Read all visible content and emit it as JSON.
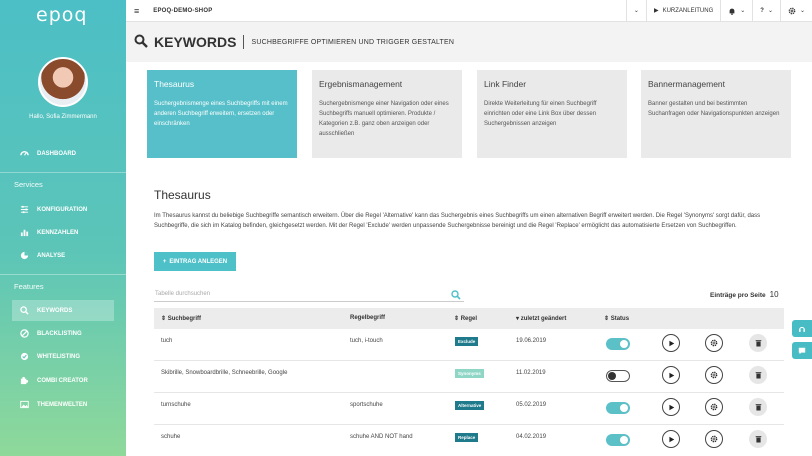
{
  "sidebar": {
    "logo": "epoq",
    "greeting": "Hallo, Sofia Zimmermann",
    "dashboard": "DASHBOARD",
    "services_label": "Services",
    "services": [
      "KONFIGURATION",
      "KENNZAHLEN",
      "ANALYSE"
    ],
    "features_label": "Features",
    "features": [
      "KEYWORDS",
      "BLACKLISTING",
      "WHITELISTING",
      "COMBI CREATOR",
      "THEMENWELTEN"
    ]
  },
  "topbar": {
    "shop": "EPOQ-DEMO-SHOP",
    "tutorial": "KURZANLEITUNG",
    "help": "?"
  },
  "header": {
    "title": "KEYWORDS",
    "subtitle": "SUCHBEGRIFFE OPTIMIEREN UND TRIGGER GESTALTEN"
  },
  "cards": [
    {
      "title": "Thesaurus",
      "desc": "Suchergebnismenge eines Suchbegriffs mit einem anderen Suchbegriff erweitern, ersetzen oder einschränken"
    },
    {
      "title": "Ergebnismanagement",
      "desc": "Suchergebnismenge einer Navigation oder eines Suchbegriffs manuell optimieren. Produkte / Kategorien z.B. ganz oben anzeigen oder ausschließen"
    },
    {
      "title": "Link Finder",
      "desc": "Direkte Weiterleitung für einen Suchbegriff einrichten oder eine Link Box über dessen Suchergebnissen anzeigen"
    },
    {
      "title": "Bannermanagement",
      "desc": "Banner gestalten und bei bestimmten Suchanfragen oder Navigationspunkten anzeigen"
    }
  ],
  "page": {
    "title": "Thesaurus",
    "description": "Im Thesaurus kannst du beliebige Suchbegriffe semantisch erweitern. Über die Regel 'Alternative' kann das Suchergebnis eines Suchbegriffs um einen alternativen Begriff erweitert werden. Die Regel 'Synonyms' sorgt dafür, dass Suchbegriffe, die sich im Katalog befinden, gleichgesetzt werden. Mit der Regel 'Exclude' werden unpassende Suchergebnisse bereinigt und die Regel 'Replace' ermöglicht das automatisierte Ersetzen von Suchbegriffen.",
    "add_button": "EINTRAG ANLEGEN",
    "search_placeholder": "Tabelle durchsuchen",
    "per_page_label": "Einträge pro Seite",
    "per_page_value": "10"
  },
  "table": {
    "headers": [
      "Suchbegriff",
      "Regelbegriff",
      "Regel",
      "zuletzt geändert",
      "Status"
    ],
    "rows": [
      {
        "term": "tuch",
        "rule_term": "tuch, i-touch",
        "rule": "Exclude",
        "date": "19.06.2019",
        "active": true
      },
      {
        "term": "Skibrille, Snowboardbrille, Schneebrille, Google",
        "rule_term": "",
        "rule": "Synonyms",
        "date": "11.02.2019",
        "active": false
      },
      {
        "term": "turnschuhe",
        "rule_term": "sportschuhe",
        "rule": "Alternative",
        "date": "05.02.2019",
        "active": true
      },
      {
        "term": "schuhe",
        "rule_term": "schuhe AND NOT hand",
        "rule": "Replace",
        "date": "04.02.2019",
        "active": true
      }
    ]
  },
  "colors": {
    "accent": "#4ec0c8",
    "badge": "#1f7a8c",
    "synonyms_badge": "#8fd6c6"
  }
}
